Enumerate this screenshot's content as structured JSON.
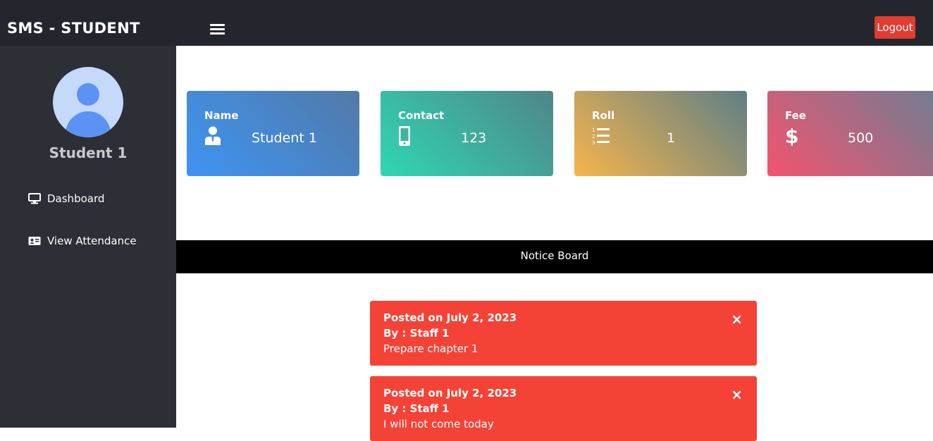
{
  "header": {
    "brand": "SMS - STUDENT",
    "menu_icon": "hamburger-icon",
    "logout_label": "Logout"
  },
  "sidebar": {
    "avatar_icon": "user-avatar-icon",
    "student_name": "Student 1",
    "items": [
      {
        "label": "Dashboard",
        "icon": "monitor-icon"
      },
      {
        "label": "View Attendance",
        "icon": "id-card-icon"
      }
    ]
  },
  "cards": [
    {
      "label": "Name",
      "value": "Student 1",
      "icon": "user-tie-icon"
    },
    {
      "label": "Contact",
      "value": "123",
      "icon": "mobile-phone-icon"
    },
    {
      "label": "Roll",
      "value": "1",
      "icon": "ordered-list-icon"
    },
    {
      "label": "Fee",
      "value": "500",
      "icon": "dollar-icon"
    }
  ],
  "notice_board": {
    "title": "Notice Board",
    "notices": [
      {
        "posted": "Posted on July 2, 2023",
        "by": "By : Staff 1",
        "message": "Prepare chapter 1",
        "close": "×"
      },
      {
        "posted": "Posted on July 2, 2023",
        "by": "By : Staff 1",
        "message": "I will not come today",
        "close": "×"
      }
    ]
  },
  "colors": {
    "topbar": "#24262d",
    "sidebar": "#2d2f36",
    "logout": "#e23b32",
    "notice": "#f44336"
  }
}
